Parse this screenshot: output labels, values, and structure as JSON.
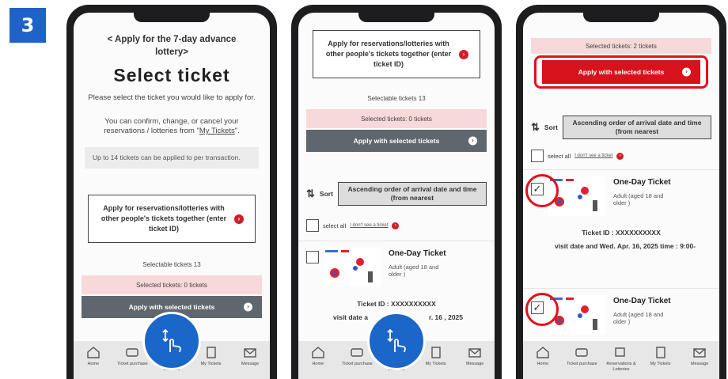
{
  "step_number": "3",
  "colors": {
    "accent_blue": "#1f63c8",
    "brand_red": "#d8121d",
    "gray_button": "#5f676e",
    "selected_count_bg": "#f7d9da"
  },
  "screen1": {
    "back_link": "< Apply for the 7-day advance lottery>",
    "title": "Select ticket",
    "instruction": "Please select the ticket you would like to apply for.",
    "manage_text_before": "You can confirm, change, or cancel your reservations / lotteries from \"",
    "manage_link": "My Tickets",
    "manage_text_after": "\".",
    "limit_note": "Up to 14 tickets can be applied to per transaction.",
    "other_people": "Apply for reservations/lotteries with other people's tickets together (enter ticket ID)",
    "selectable": "Selectable tickets 13",
    "selected": "Selected tickets: 0 tickets",
    "apply_button": "Apply with selected tickets"
  },
  "screen2": {
    "other_people": "Apply for reservations/lotteries with other people's tickets together (enter ticket ID)",
    "selectable": "Selectable tickets 13",
    "selected": "Selected tickets: 0 tickets",
    "apply_button": "Apply with selected tickets",
    "sort_label": "Sort",
    "sort_option": "Ascending order of arrival date and time (from nearest",
    "select_all": "select all",
    "no_ticket_link": "I don't see a ticket",
    "ticket_name": "One-Day Ticket",
    "ticket_sub": "Adult (aged 18 and older )",
    "ticket_id": "Ticket ID : XXXXXXXXXX",
    "visit_partial": "visit date a",
    "visit_date_partial": "r. 16 , 2025"
  },
  "screen3": {
    "selected": "Selected tickets: 2 tickets",
    "apply_button": "Apply with selected tickets",
    "sort_label": "Sort",
    "sort_option": "Ascending order of arrival date and time (from nearest",
    "select_all": "select all",
    "no_ticket_link": "I don't see a ticket",
    "ticket1_name": "One-Day Ticket",
    "ticket1_sub": "Adult (aged 18 and older )",
    "ticket1_id": "Ticket ID : XXXXXXXXXX",
    "ticket1_visit": "visit date and Wed. Apr. 16, 2025 time : 9:00-",
    "ticket2_name": "One-Day Ticket",
    "ticket2_sub": "Adult (aged 18 and older )"
  },
  "tabbar": {
    "home": "Home",
    "ticket_purchase": "Ticket purchase",
    "reservations": "Reservations & Lotteries",
    "my_tickets": "My Tickets",
    "message": "Message"
  }
}
